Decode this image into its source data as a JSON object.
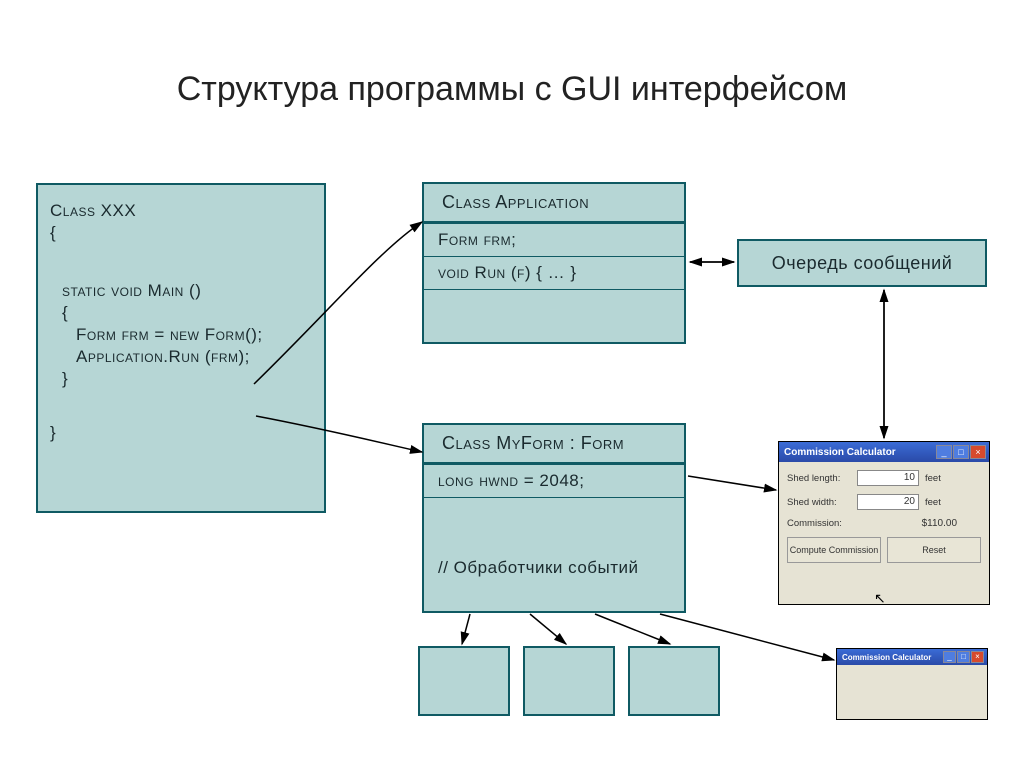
{
  "slide": {
    "title": "Структура программы с GUI интерфейсом"
  },
  "classXXX": {
    "l0": "Class XXX",
    "l1": "{",
    "l2": "static void Main ()",
    "l3": "{",
    "l4": "Form frm = new Form();",
    "l5": "Application.Run (frm);",
    "l6": "}",
    "l7": "}"
  },
  "classApp": {
    "hdr": "Class Application",
    "r1": "Form frm;",
    "r2": "void Run (f) { … }"
  },
  "classForm": {
    "hdr": "Class MyForm : Form",
    "r1": "long hwnd = 2048;",
    "r2": "// Обработчики событий"
  },
  "msgQueue": {
    "label": "Очередь сообщений"
  },
  "calc": {
    "title": "Commission Calculator",
    "len_label": "Shed length:",
    "wid_label": "Shed width:",
    "com_label": "Commission:",
    "len_value": "10",
    "wid_value": "20",
    "com_value": "$110.00",
    "unit": "feet",
    "btn_compute": "Compute Commission",
    "btn_reset": "Reset"
  },
  "calc2": {
    "title": "Commission Calculator"
  }
}
